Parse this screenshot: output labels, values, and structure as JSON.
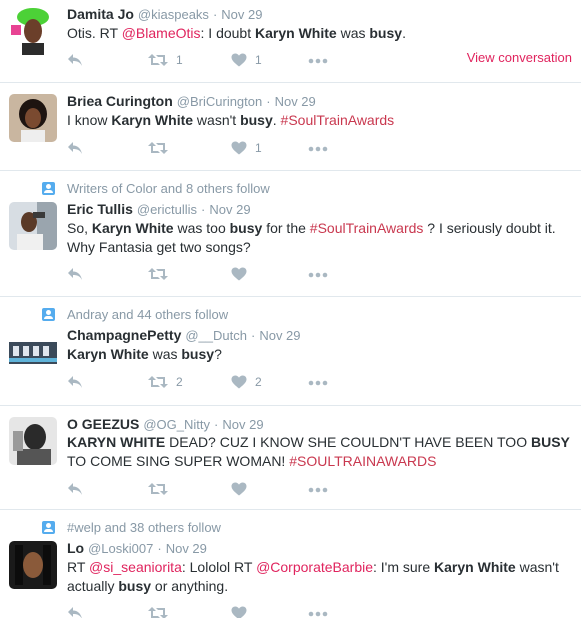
{
  "colors": {
    "link": "#e0245e",
    "hashtag": "#c9384f",
    "meta": "#8899a6",
    "icon": "#aab8c2",
    "context_icon": "#55acee"
  },
  "icons": {
    "reply": "reply-icon",
    "retweet": "retweet-icon",
    "like": "heart-icon",
    "more": "more-dots-icon",
    "context": "follow-context-icon"
  },
  "tweets": [
    {
      "context": "",
      "fullname": "Damita Jo",
      "username": "@kiaspeaks",
      "sep": "·",
      "time": "Nov 29",
      "text": [
        {
          "t": "Otis. RT "
        },
        {
          "t": "@BlameOtis",
          "k": "link"
        },
        {
          "t": ": I doubt "
        },
        {
          "t": "Karyn White",
          "k": "b"
        },
        {
          "t": " was "
        },
        {
          "t": "busy",
          "k": "b"
        },
        {
          "t": "."
        }
      ],
      "retweets": "1",
      "likes": "1",
      "view_conversation": "View conversation"
    },
    {
      "context": "",
      "fullname": "Briea Curington",
      "username": "@BriCurington",
      "sep": "·",
      "time": "Nov 29",
      "text": [
        {
          "t": "I know "
        },
        {
          "t": "Karyn White",
          "k": "b"
        },
        {
          "t": " wasn't "
        },
        {
          "t": "busy",
          "k": "b"
        },
        {
          "t": ". "
        },
        {
          "t": "#SoulTrainAwards",
          "k": "hashtag"
        }
      ],
      "retweets": "",
      "likes": "1",
      "view_conversation": ""
    },
    {
      "context": "Writers of Color and 8 others follow",
      "fullname": "Eric Tullis",
      "username": "@erictullis",
      "sep": "·",
      "time": "Nov 29",
      "text": [
        {
          "t": "So, "
        },
        {
          "t": "Karyn White",
          "k": "b"
        },
        {
          "t": " was too "
        },
        {
          "t": "busy",
          "k": "b"
        },
        {
          "t": " for the "
        },
        {
          "t": "#SoulTrainAwards",
          "k": "hashtag"
        },
        {
          "t": " ? I seriously doubt it. Why Fantasia get two songs?"
        }
      ],
      "retweets": "",
      "likes": "",
      "view_conversation": ""
    },
    {
      "context": "Andray and 44 others follow",
      "fullname": "ChampagnePetty",
      "username": "@__Dutch",
      "sep": "·",
      "time": "Nov 29",
      "text": [
        {
          "t": "Karyn White",
          "k": "b"
        },
        {
          "t": " was "
        },
        {
          "t": "busy",
          "k": "b"
        },
        {
          "t": "?"
        }
      ],
      "retweets": "2",
      "likes": "2",
      "view_conversation": ""
    },
    {
      "context": "",
      "fullname": "O GEEZUS",
      "username": "@OG_Nitty",
      "sep": "·",
      "time": "Nov 29",
      "text": [
        {
          "t": "KARYN WHITE",
          "k": "b"
        },
        {
          "t": " DEAD?  CUZ I KNOW SHE COULDN'T HAVE BEEN TOO "
        },
        {
          "t": "BUSY",
          "k": "b"
        },
        {
          "t": " TO COME SING SUPER WOMAN! "
        },
        {
          "t": "#SOULTRAINAWARDS",
          "k": "hashtag"
        }
      ],
      "retweets": "",
      "likes": "",
      "view_conversation": ""
    },
    {
      "context": "#welp and 38 others follow",
      "fullname": "Lo",
      "username": "@Loski007",
      "sep": "·",
      "time": "Nov 29",
      "text": [
        {
          "t": "RT "
        },
        {
          "t": "@si_seaniorita",
          "k": "link"
        },
        {
          "t": ": Lololol RT "
        },
        {
          "t": "@CorporateBarbie",
          "k": "link"
        },
        {
          "t": ": I'm sure "
        },
        {
          "t": "Karyn White",
          "k": "b"
        },
        {
          "t": " wasn't actually "
        },
        {
          "t": "busy",
          "k": "b"
        },
        {
          "t": " or anything."
        }
      ],
      "retweets": "",
      "likes": "",
      "view_conversation": ""
    }
  ]
}
